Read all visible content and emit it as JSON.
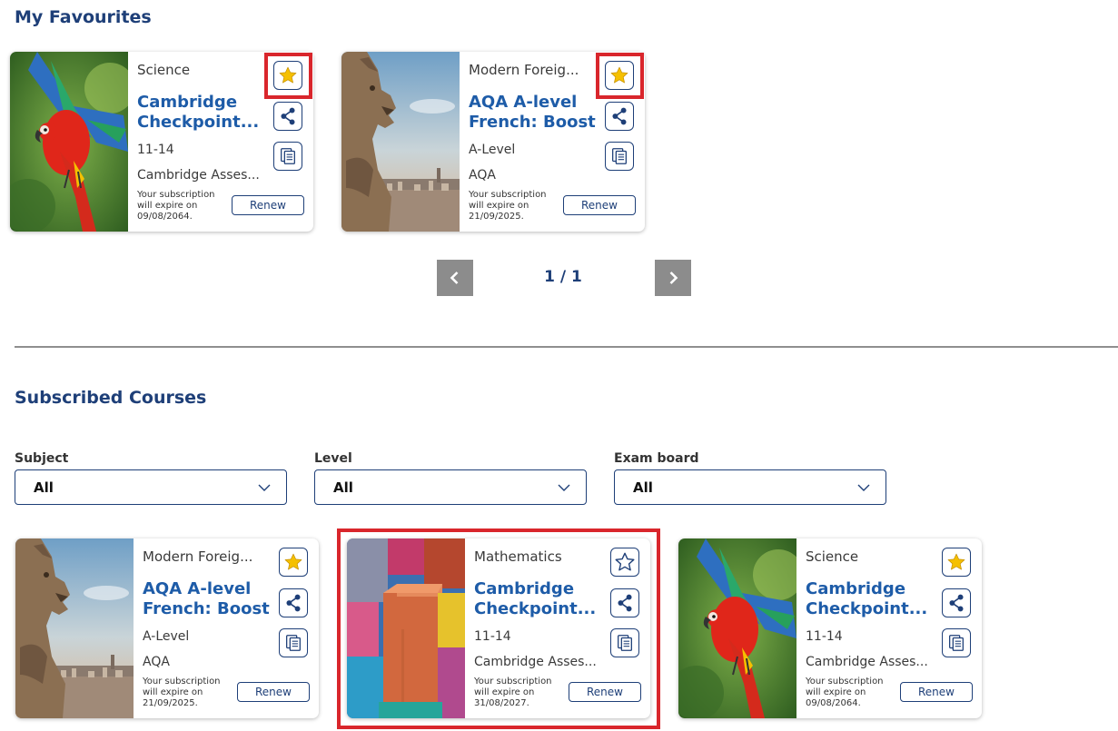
{
  "favourites": {
    "heading": "My Favourites",
    "cards": [
      {
        "subject": "Science",
        "title_line1": "Cambridge",
        "title_line2": "Checkpoint...",
        "level": "11-14",
        "board": "Cambridge Asses...",
        "expiry": "Your subscription will expire on 09/08/2064.",
        "renew": "Renew",
        "favourited": true,
        "image": "parrot"
      },
      {
        "subject": "Modern Foreig...",
        "title_line1": "AQA A-level",
        "title_line2": "French: Boost",
        "level": "A-Level",
        "board": "AQA",
        "expiry": "Your subscription will expire on 21/09/2025.",
        "renew": "Renew",
        "favourited": true,
        "image": "gargoyle"
      }
    ],
    "pagination": {
      "info": "1 / 1",
      "prev_icon": "chevron-left-icon",
      "next_icon": "chevron-right-icon"
    }
  },
  "subscribed": {
    "heading": "Subscribed Courses",
    "filters": [
      {
        "label": "Subject",
        "value": "All"
      },
      {
        "label": "Level",
        "value": "All"
      },
      {
        "label": "Exam board",
        "value": "All"
      }
    ],
    "cards": [
      {
        "subject": "Modern Foreig...",
        "title_line1": "AQA A-level",
        "title_line2": "French: Boost",
        "level": "A-Level",
        "board": "AQA",
        "expiry": "Your subscription will expire on 21/09/2025.",
        "renew": "Renew",
        "favourited": true,
        "image": "gargoyle"
      },
      {
        "subject": "Mathematics",
        "title_line1": "Cambridge",
        "title_line2": "Checkpoint...",
        "level": "11-14",
        "board": "Cambridge Asses...",
        "expiry": "Your subscription will expire on 31/08/2027.",
        "renew": "Renew",
        "favourited": false,
        "image": "blocks"
      },
      {
        "subject": "Science",
        "title_line1": "Cambridge",
        "title_line2": "Checkpoint...",
        "level": "11-14",
        "board": "Cambridge Asses...",
        "expiry": "Your subscription will expire on 09/08/2064.",
        "renew": "Renew",
        "favourited": true,
        "image": "parrot"
      }
    ]
  },
  "colors": {
    "accent": "#1e3f78",
    "title": "#1e5ca8",
    "star": "#f5c000",
    "highlight": "#d9262c",
    "pager": "#8c8c8c"
  },
  "icons": {
    "favourite": "star-icon",
    "share": "share-icon",
    "copy": "copy-icon",
    "dropdown": "chevron-down-icon"
  }
}
